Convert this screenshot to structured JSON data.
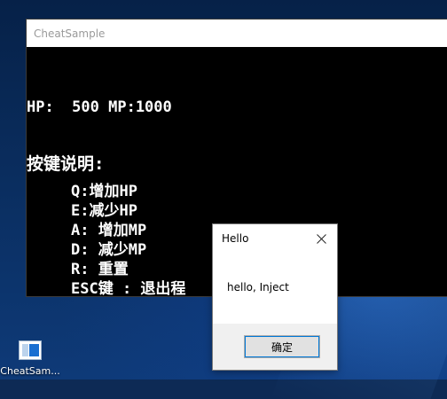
{
  "console": {
    "title": "CheatSample",
    "hp_mp_line": "HP:  500 MP:1000",
    "keys_header": "按键说明:",
    "keys": [
      "Q:增加HP",
      "E:减少HP",
      "A: 增加MP",
      "D: 减少MP",
      "R: 重置",
      "ESC键 : 退出程"
    ]
  },
  "msgbox": {
    "title": "Hello",
    "message": "hello, Inject",
    "ok_label": "确定",
    "close_icon": "close-icon"
  },
  "desktop": {
    "icon_label": "CheatSam..."
  }
}
